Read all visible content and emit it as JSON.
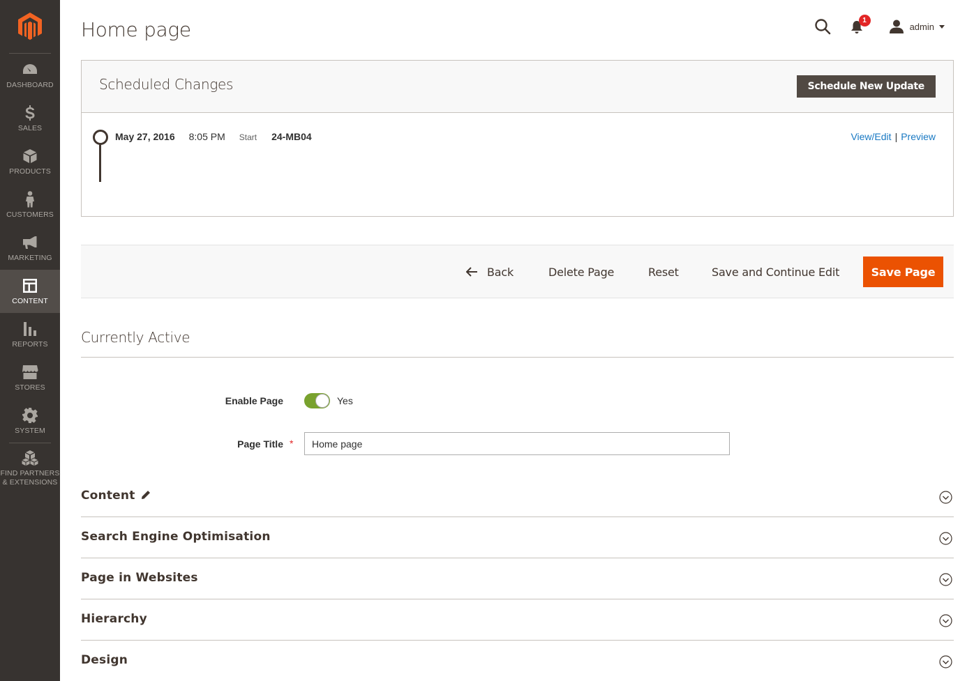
{
  "sidebar": {
    "logo": "magento-logo",
    "items": [
      {
        "label": "DASHBOARD",
        "icon": "dashboard-icon"
      },
      {
        "label": "SALES",
        "icon": "dollar-icon"
      },
      {
        "label": "PRODUCTS",
        "icon": "box-icon"
      },
      {
        "label": "CUSTOMERS",
        "icon": "person-icon"
      },
      {
        "label": "MARKETING",
        "icon": "megaphone-icon"
      },
      {
        "label": "CONTENT",
        "icon": "layout-icon",
        "active": true
      },
      {
        "label": "REPORTS",
        "icon": "bar-chart-icon"
      },
      {
        "label": "STORES",
        "icon": "store-icon"
      },
      {
        "label": "SYSTEM",
        "icon": "gear-icon"
      },
      {
        "label": "FIND PARTNERS & EXTENSIONS",
        "icon": "cubes-icon"
      }
    ]
  },
  "header": {
    "title": "Home page",
    "notification_count": "1",
    "user": "admin"
  },
  "scheduled": {
    "title": "Scheduled Changes",
    "button": "Schedule New Update",
    "entry": {
      "date": "May 27, 2016",
      "time": "8:05 PM",
      "type": "Start",
      "code": "24-MB04"
    },
    "links": {
      "view_edit": "View/Edit",
      "separator": "|",
      "preview": "Preview"
    }
  },
  "actions": {
    "back": "Back",
    "delete": "Delete Page",
    "reset": "Reset",
    "save_continue": "Save and Continue Edit",
    "save": "Save Page"
  },
  "form": {
    "section_title": "Currently Active",
    "enable_label": "Enable Page",
    "enable_value": "Yes",
    "title_label": "Page Title",
    "required_mark": "*",
    "title_value": "Home page"
  },
  "sections": [
    {
      "title": "Content"
    },
    {
      "title": "Search Engine Optimisation"
    },
    {
      "title": "Page in Websites"
    },
    {
      "title": "Hierarchy"
    },
    {
      "title": "Design"
    }
  ],
  "colors": {
    "sidebar_bg": "#373330",
    "accent_orange": "#eb5202",
    "toggle_green": "#79a22e",
    "link_blue": "#1979c3",
    "badge_red": "#e22626"
  }
}
